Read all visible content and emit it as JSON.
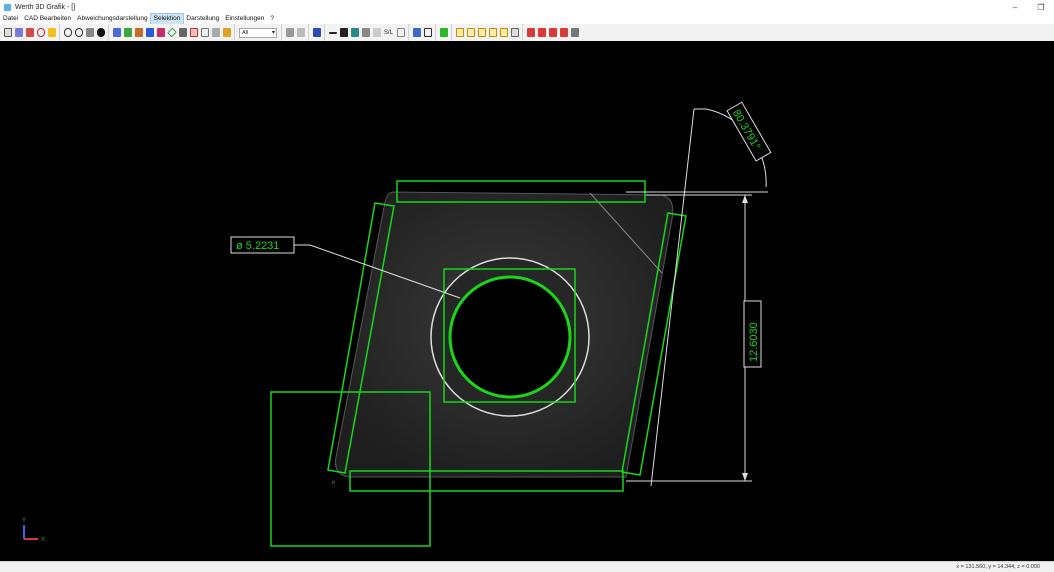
{
  "window": {
    "title": "Werth 3D Grafik - []",
    "minimize": "–",
    "maximize": "❐"
  },
  "menu": [
    {
      "label": "Datei"
    },
    {
      "label": "CAD Bearbeiten"
    },
    {
      "label": "Abweichungsdarstellung"
    },
    {
      "label": "Selektion",
      "active": true
    },
    {
      "label": "Darstellung"
    },
    {
      "label": "Einstellungen"
    },
    {
      "label": "?"
    }
  ],
  "toolbar": {
    "view_select": "All",
    "text_button": "S/L",
    "icons": [
      "select-icon",
      "probe-icon",
      "pen-icon",
      "curve-icon",
      "lightning-icon",
      "zoom-window-icon",
      "zoom-fit-icon",
      "pan-icon",
      "point-icon",
      "cube-icon",
      "fit-icon",
      "element-icon",
      "palette-icon",
      "color-icon",
      "diamond-icon",
      "flag-icon",
      "grid-icon",
      "table-icon",
      "layer-icon",
      "funnel-icon",
      "eraser-icon",
      "link-icon",
      "pin-icon",
      "minus-icon",
      "plus-icon",
      "arrow-icon",
      "cut-icon",
      "check-icon",
      "frame-icon",
      "measure-icon",
      "scan-icon",
      "green-shape-icon",
      "box1-icon",
      "box2-icon",
      "box3-icon",
      "box4-icon",
      "box5-icon",
      "box6-icon",
      "mark1-icon",
      "mark2-icon",
      "mark3-icon",
      "mark4-icon",
      "hand-icon"
    ]
  },
  "viewport": {
    "annotations": {
      "diameter": "ø 5.2231",
      "angle": "80.3791°",
      "distance": "12.6030"
    },
    "axis_labels": {
      "x": "X",
      "y": "Y"
    }
  },
  "status": {
    "coords": "x = 131.560, y = 14.344, z = 0.000"
  },
  "colors": {
    "fit_green": "#19d61a",
    "annotation_white": "#dddddd",
    "background": "#000000"
  }
}
